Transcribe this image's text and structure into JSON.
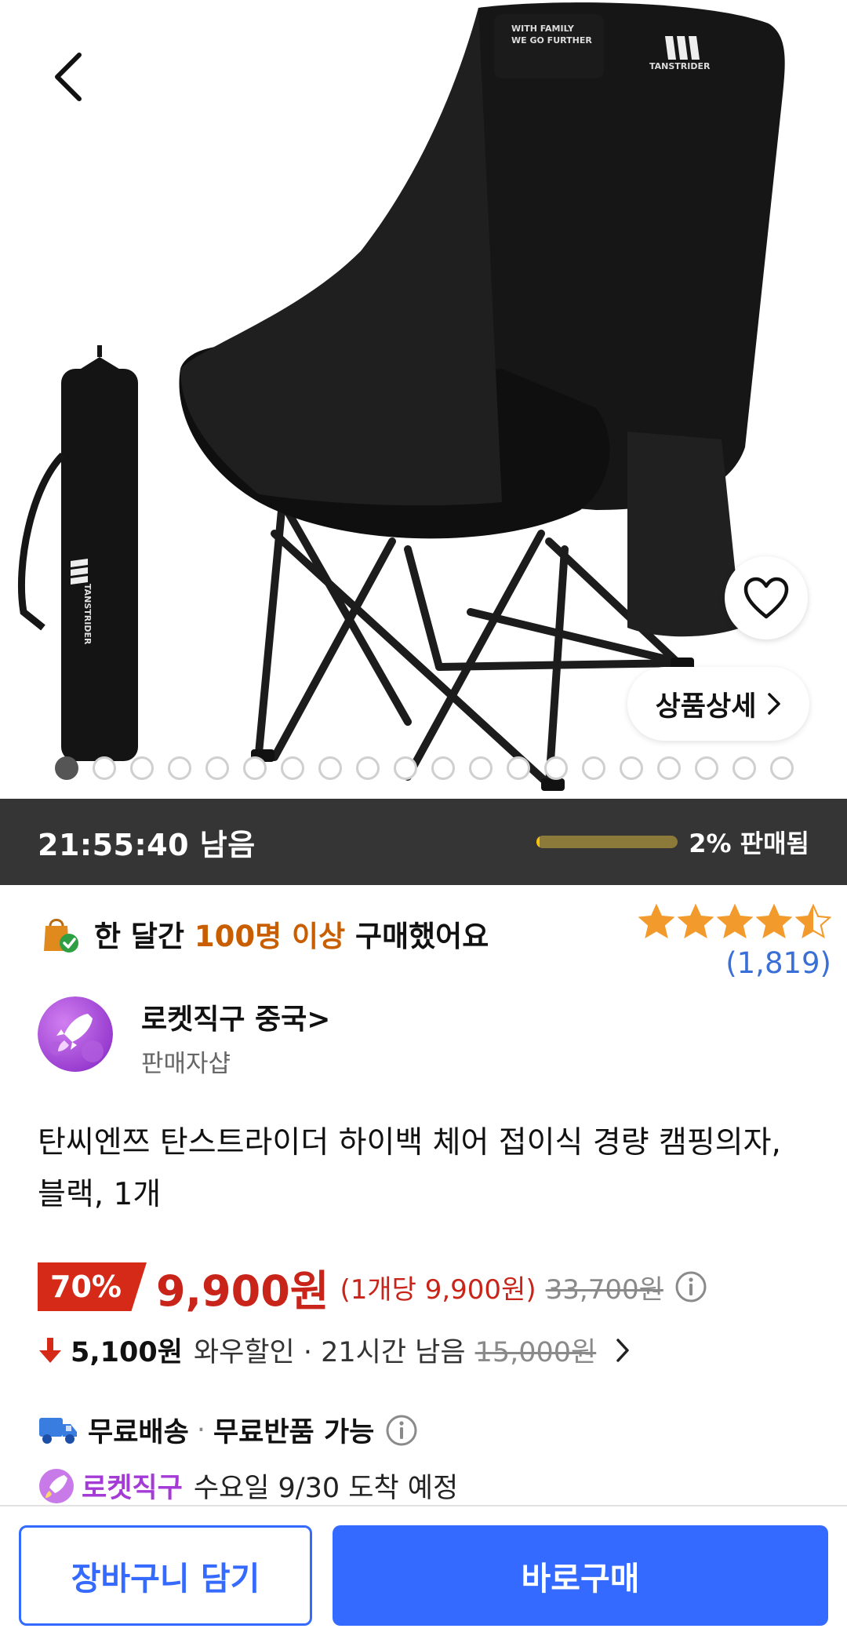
{
  "hero": {
    "back_icon": "chevron-left-icon",
    "wishlist_icon": "heart-icon",
    "detail_label": "상품상세",
    "bag_brand": "TANSTRIDER",
    "chair_brand": "TANSTRIDER",
    "chair_slogan": "WITH FAMILY\nWE GO FURTHER",
    "image_count": 20,
    "active_index": 0
  },
  "timer": {
    "remaining": "21:55:40 남음",
    "sold_fraction": 0.02,
    "sold_label": "2% 판매됨",
    "colors": {
      "bar_bg": "#353535",
      "fill": "#f7c30a"
    }
  },
  "buyers": {
    "prefix": "한 달간",
    "highlight": "100명 이상",
    "suffix": "구매했어요",
    "icon": "shopping-bag-check-icon"
  },
  "rating": {
    "stars": 4.5,
    "review_count": "(1,819)"
  },
  "seller": {
    "name": "로켓직구 중국",
    "sub": "판매자샵",
    "logo_icon": "rocket-icon"
  },
  "product": {
    "title": "탄씨엔쯔 탄스트라이더 하이백 체어 접이식 경량 캠핑의자, 블랙, 1개"
  },
  "price": {
    "discount": "70%",
    "sale": "9,900원",
    "unit": "(1개당 9,900원)",
    "original": "33,700원",
    "info_icon": "info-icon"
  },
  "wow": {
    "amount": "5,100원",
    "text": "와우할인 · 21시간 남음",
    "original": "15,000원",
    "arrow_icon": "arrow-down-icon"
  },
  "shipping": {
    "free_delivery": "무료배송",
    "free_return": "무료반품 가능",
    "truck_icon": "truck-icon"
  },
  "rocket": {
    "label": "로켓직구",
    "eta": "수요일 9/30 도착 예정"
  },
  "actions": {
    "cart": "장바구니 담기",
    "buy": "바로구매"
  },
  "colors": {
    "accent_blue": "#346aff",
    "price_red": "#c8241a",
    "highlight_orange": "#c95e00",
    "rocket_purple": "#a43bd6",
    "star": "#f39a2c"
  }
}
